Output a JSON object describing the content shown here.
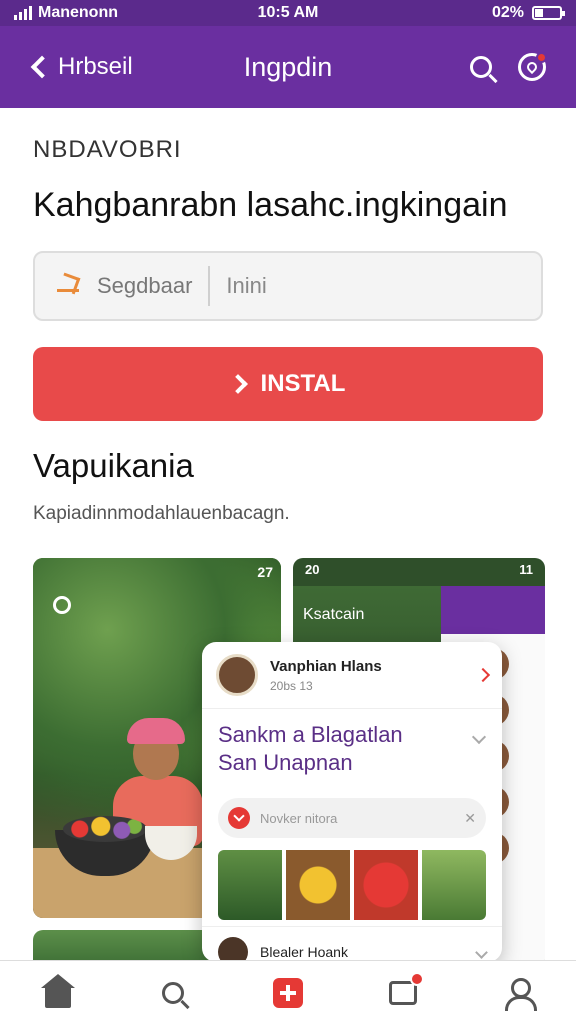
{
  "status_bar": {
    "carrier": "Manenonn",
    "time": "10:5 AM",
    "battery": "02%"
  },
  "header": {
    "back_label": "Hrbseil",
    "title": "Ingpdin"
  },
  "main": {
    "kicker": "NBDAVOBRI",
    "headline": "Kahgbanrabn lasahc.ingkingain",
    "input": {
      "placeholder": "Segdbaar",
      "unit": "Inini"
    },
    "install_label": "INSTAL",
    "section_title": "Vapuikania",
    "section_sub": "Kapiadinnmodahlauenbacagn."
  },
  "gallery": {
    "left_badge": "27",
    "right_time": "20",
    "right_status": "11",
    "right_label": "Ksatcain"
  },
  "card": {
    "name": "Vanphian Hlans",
    "time": "20bs 13",
    "title_line1": "Sankm a Blagatlan",
    "title_line2": "San Unapnan",
    "input_placeholder": "Novker nitora",
    "footer_name": "Blealer Hoank"
  },
  "icons": {
    "back": "chevron-left-icon",
    "search": "search-icon",
    "notifications": "notification-heart-icon",
    "input": "edit-pencil-icon",
    "install": "chevron-right-icon",
    "nav": [
      "home-icon",
      "search-icon",
      "add-icon",
      "messages-icon",
      "profile-icon"
    ]
  },
  "colors": {
    "header": "#6a2fa0",
    "status_bar": "#5b2a8c",
    "accent": "#e84a4a",
    "card_title": "#5a2f86"
  }
}
